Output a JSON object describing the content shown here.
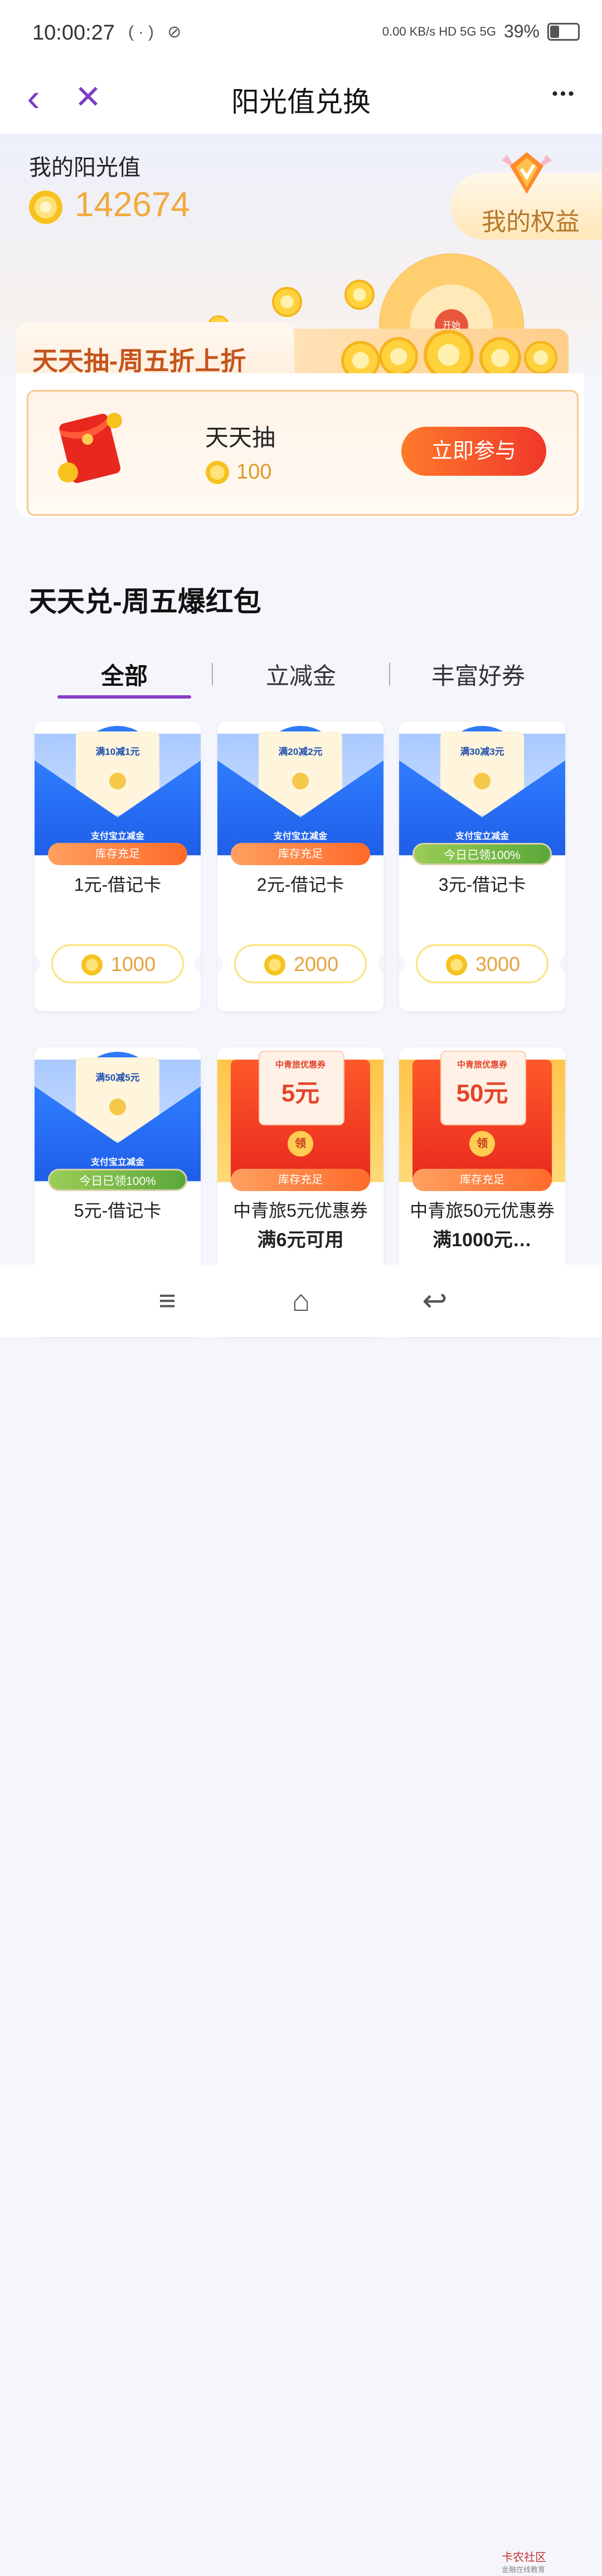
{
  "status_bar": {
    "time": "10:00:27",
    "left_icons": "(·) ⊘",
    "right_text": "0.00 KB/s  HD  5G  5G",
    "battery": "39%"
  },
  "titlebar": {
    "back_icon": "‹",
    "close_icon": "✕",
    "title": "阳光值兑换",
    "more_icon": "•••"
  },
  "header": {
    "label": "我的阳光值",
    "value": "142674",
    "rights_label": "我的权益"
  },
  "lottery": {
    "section_title": "天天抽-周五折上折",
    "name": "天天抽",
    "cost": "100",
    "button": "立即参与",
    "wheel_start": "开始"
  },
  "exchange": {
    "section_title": "天天兑-周五爆红包",
    "tabs": [
      "全部",
      "立减金",
      "丰富好券"
    ],
    "cards": [
      {
        "env_amount": "满10减1元",
        "env_label": "支付宝立减金",
        "badge": "库存充足",
        "badge_type": "orange",
        "name": "1元-借记卡",
        "sub": "",
        "price": "1000"
      },
      {
        "env_amount": "满20减2元",
        "env_label": "支付宝立减金",
        "badge": "库存充足",
        "badge_type": "orange",
        "name": "2元-借记卡",
        "sub": "",
        "price": "2000"
      },
      {
        "env_amount": "满30减3元",
        "env_label": "支付宝立减金",
        "badge": "今日已领100%",
        "badge_type": "green",
        "name": "3元-借记卡",
        "sub": "",
        "price": "3000"
      },
      {
        "env_amount": "满50减5元",
        "env_label": "支付宝立减金",
        "badge": "今日已领100%",
        "badge_type": "green",
        "name": "5元-借记卡",
        "sub": "",
        "price": ""
      },
      {
        "paper_title": "中青旅优惠券",
        "paper_amount": "5元",
        "seal": "领",
        "badge": "库存充足",
        "badge_type": "orange",
        "name": "中青旅5元优惠券",
        "sub": "满6元可用",
        "price": ""
      },
      {
        "paper_title": "中青旅优惠券",
        "paper_amount": "50元",
        "seal": "领",
        "badge": "库存充足",
        "badge_type": "orange",
        "name": "中青旅50元优惠券",
        "sub": "满1000元…",
        "price": ""
      }
    ]
  },
  "navbar": {
    "menu_icon": "≡",
    "home_icon": "⌂",
    "back_icon": "↩"
  },
  "watermark": {
    "line1": "卡农社区",
    "line2": "金融在线教育"
  },
  "colors": {
    "accent_purple": "#8a3dc8",
    "sun_orange": "#f2a93b",
    "button_red": "#f0382b"
  }
}
